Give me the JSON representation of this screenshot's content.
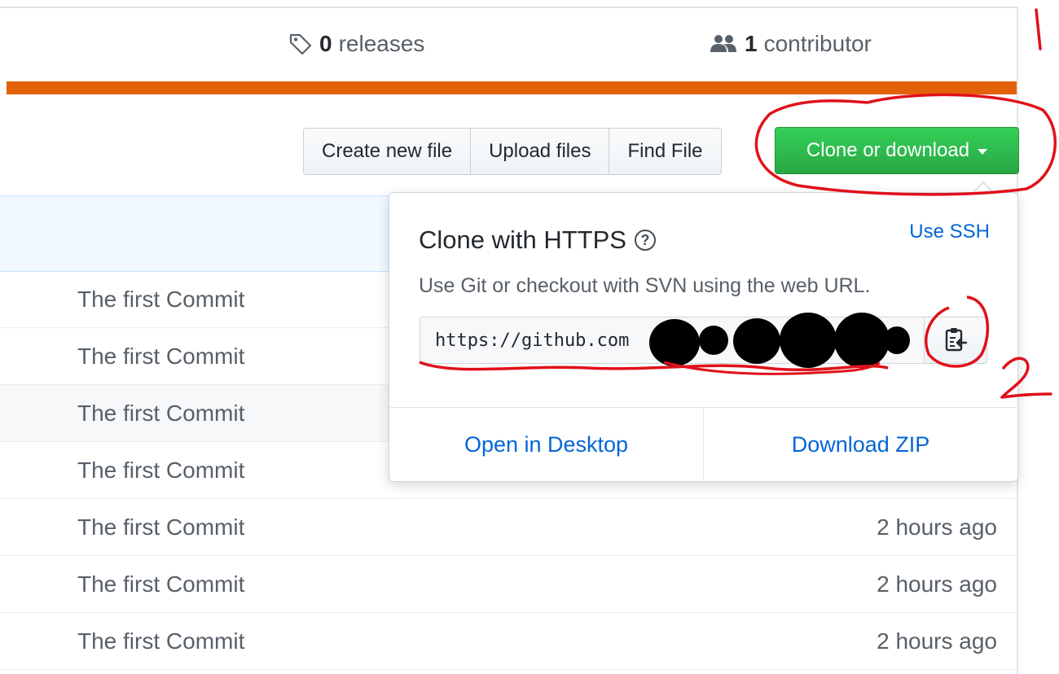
{
  "summary": {
    "releases_count": "0",
    "releases_label": "releases",
    "contributors_count": "1",
    "contributors_label": "contributor"
  },
  "colors": {
    "language_bar": "#e36209",
    "clone_button": "#28a745",
    "link": "#0366d6",
    "annotation": "#e0111a"
  },
  "toolbar": {
    "create_new_file": "Create new file",
    "upload_files": "Upload files",
    "find_file": "Find File",
    "clone_or_download": "Clone or download"
  },
  "clone_popup": {
    "title": "Clone with HTTPS",
    "help_icon": "question-circle-icon",
    "use_ssh": "Use SSH",
    "description": "Use Git or checkout with SVN using the web URL.",
    "url_value": "https://github.com",
    "copy_icon": "clipboard-icon",
    "open_in_desktop": "Open in Desktop",
    "download_zip": "Download ZIP"
  },
  "files": [
    {
      "message": "The first Commit",
      "age": ""
    },
    {
      "message": "The first Commit",
      "age": ""
    },
    {
      "message": "The first Commit",
      "age": ""
    },
    {
      "message": "The first Commit",
      "age": ""
    },
    {
      "message": "The first Commit",
      "age": "2 hours ago"
    },
    {
      "message": "The first Commit",
      "age": "2 hours ago"
    },
    {
      "message": "The first Commit",
      "age": "2 hours ago"
    }
  ],
  "annotations": {
    "step1": "1",
    "step2": "2"
  }
}
